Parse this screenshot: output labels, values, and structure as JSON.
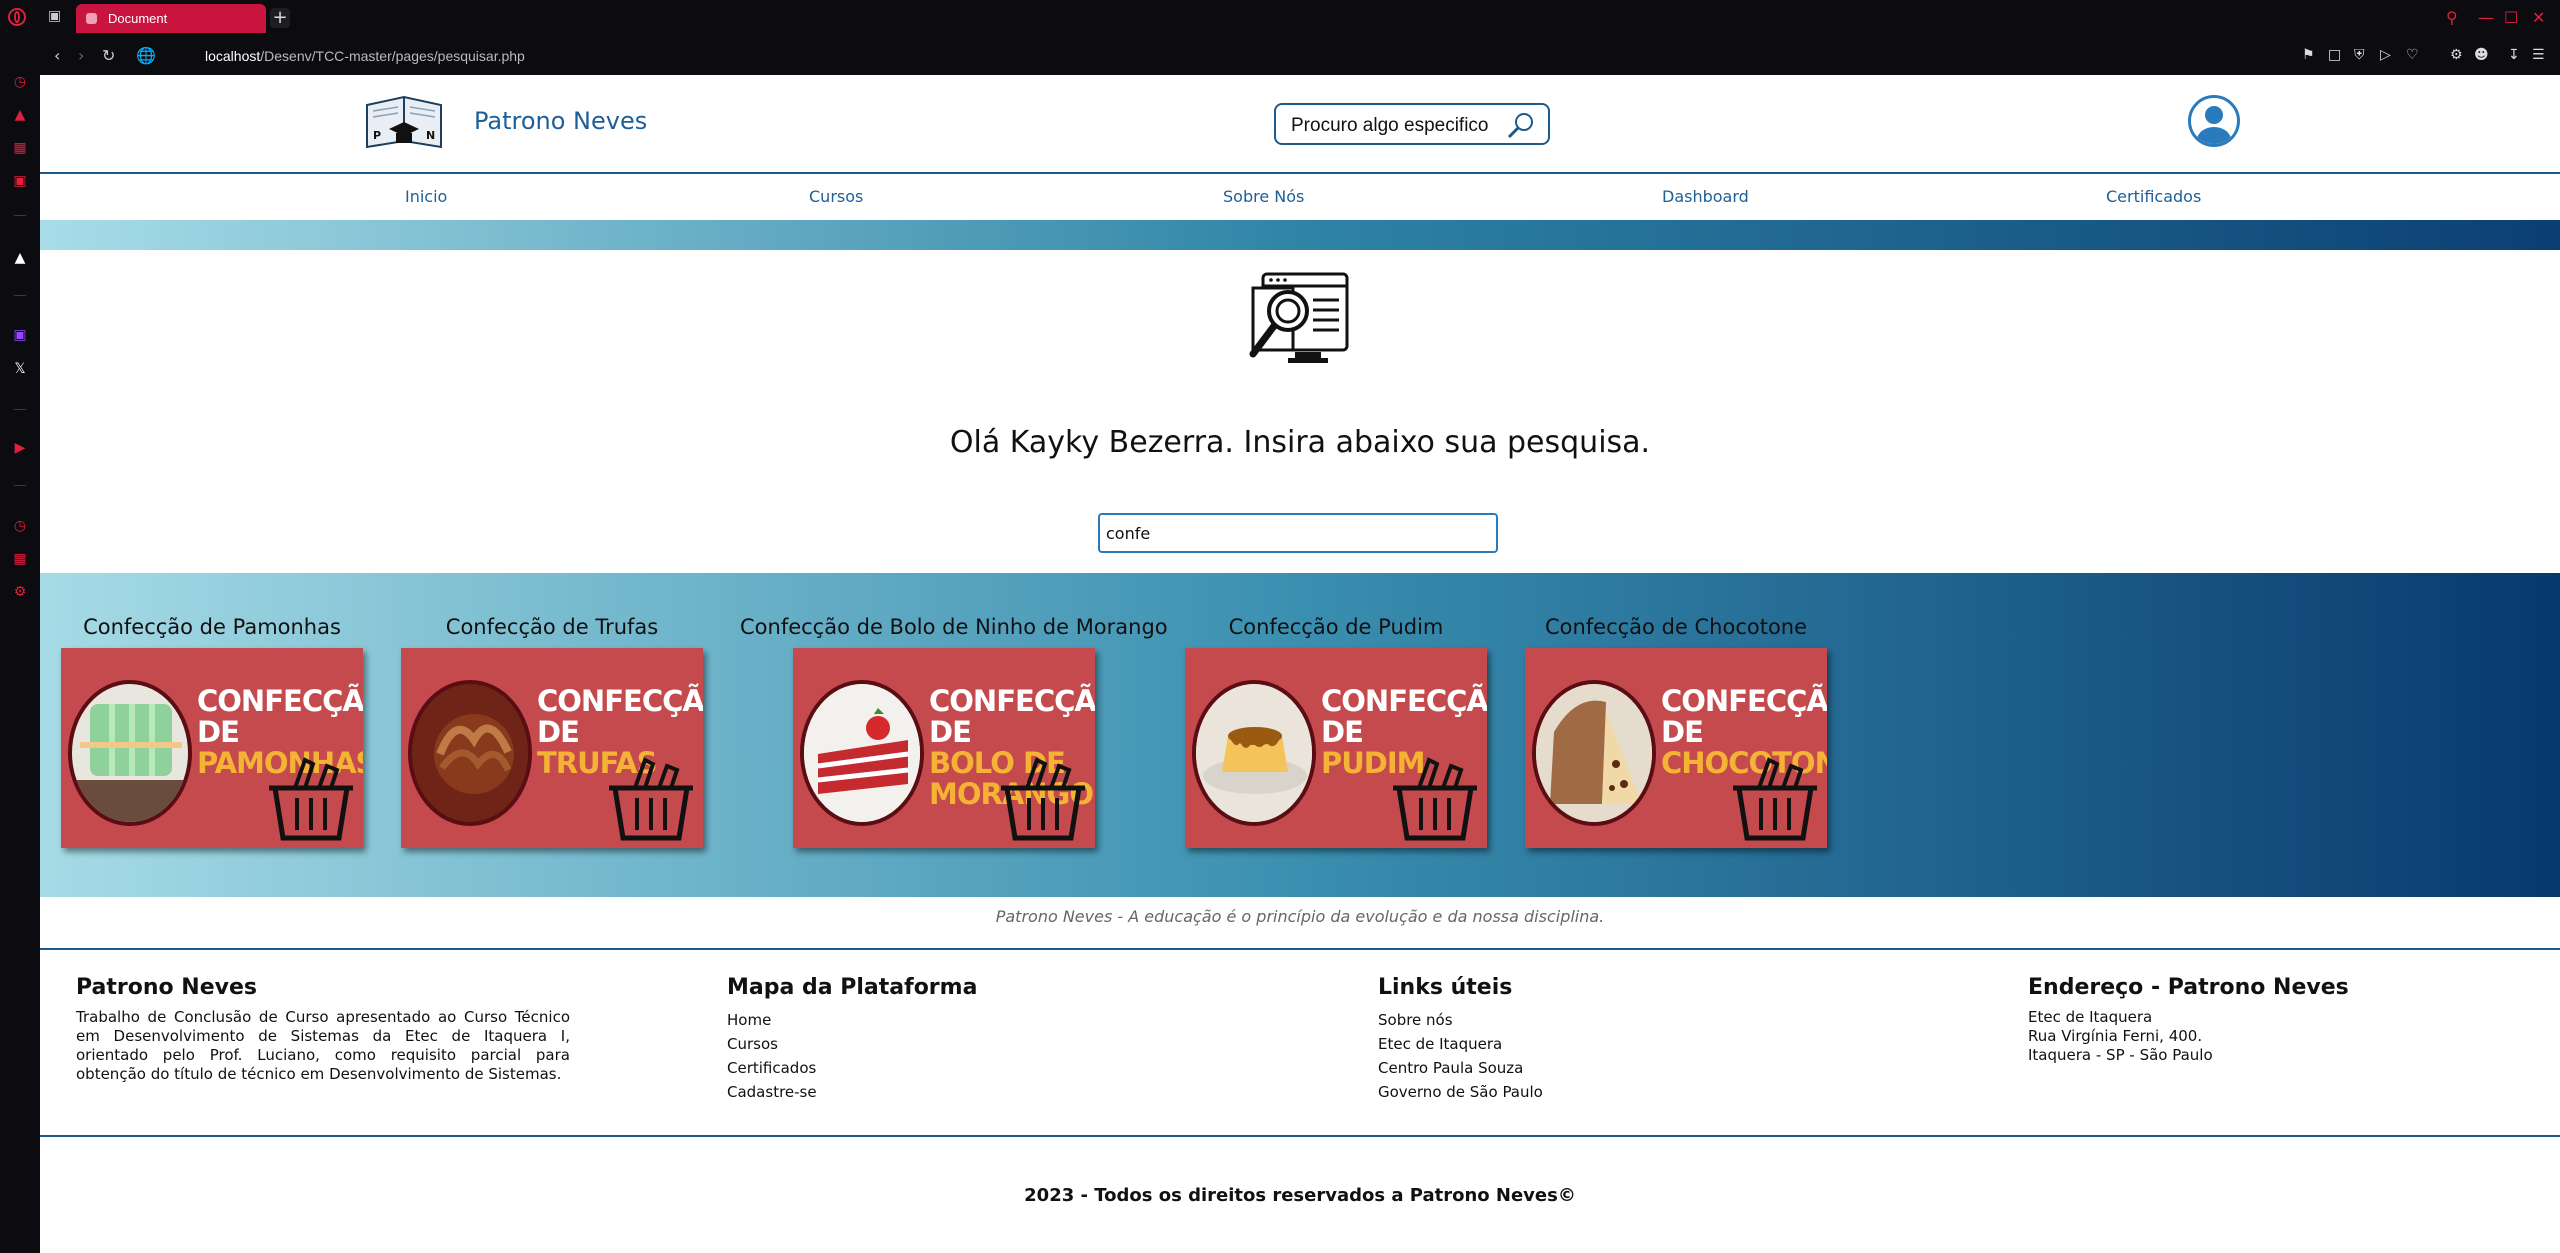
{
  "browser": {
    "tab_title": "Document",
    "url_host": "localhost",
    "url_path": "/Desenv/TCC-master/pages/pesquisar.php"
  },
  "header": {
    "logo_letters": [
      "P",
      "N"
    ],
    "site_title": "Patrono Neves",
    "search_button_label": "Procuro algo especifico"
  },
  "menu": {
    "items": [
      "Inicio",
      "Cursos",
      "Sobre Nós",
      "Dashboard",
      "Certificados"
    ]
  },
  "main": {
    "greeting": "Olá Kayky Bezerra. Insira abaixo sua pesquisa.",
    "query_value": "confe"
  },
  "results": [
    {
      "title": "Confecção de Pamonhas",
      "img_line1": "CONFECÇÃO",
      "img_line2": "DE",
      "img_line3": "PAMONHAS",
      "img_line4": ""
    },
    {
      "title": "Confecção de Trufas",
      "img_line1": "CONFECÇÃO",
      "img_line2": "DE",
      "img_line3": "TRUFAS",
      "img_line4": ""
    },
    {
      "title": "Confecção de Bolo de Ninho de Morango",
      "img_line1": "CONFECÇÃO",
      "img_line2": "DE",
      "img_line3": "BOLO DE",
      "img_line4": "MORANGO"
    },
    {
      "title": "Confecção de Pudim",
      "img_line1": "CONFECÇÃO",
      "img_line2": "DE",
      "img_line3": "PUDIM",
      "img_line4": ""
    },
    {
      "title": "Confecção de Chocotone",
      "img_line1": "CONFECÇÃO",
      "img_line2": "DE",
      "img_line3": "CHOCOTONE",
      "img_line4": ""
    }
  ],
  "motto": "Patrono Neves - A educação é o princípio da evolução e da nossa disciplina.",
  "footer": {
    "about": {
      "title": "Patrono Neves",
      "text": "Trabalho de Conclusão de Curso apresentado ao Curso Técnico em Desenvolvimento de Sistemas da Etec de Itaquera I, orientado pelo Prof. Luciano, como requisito parcial para obtenção do título de técnico em Desenvolvimento de Sistemas."
    },
    "map": {
      "title": "Mapa da Plataforma",
      "links": [
        "Home",
        "Cursos",
        "Certificados",
        "Cadastre-se"
      ]
    },
    "useful": {
      "title": "Links úteis",
      "links": [
        "Sobre nós",
        "Etec de Itaquera",
        "Centro Paula Souza",
        "Governo de São Paulo"
      ]
    },
    "address": {
      "title": "Endereço - Patrono Neves",
      "lines": [
        "Etec de Itaquera",
        "Rua Virgínia Ferni, 400.",
        "Itaquera - SP - São Paulo"
      ]
    },
    "copyright": "2023 - Todos os direitos reservados a Patrono Neves©"
  },
  "colors": {
    "accent": "#1d5f98",
    "card_bg": "#c44a4d",
    "card_highlight": "#f5b335",
    "browser_red": "#e0203d"
  }
}
